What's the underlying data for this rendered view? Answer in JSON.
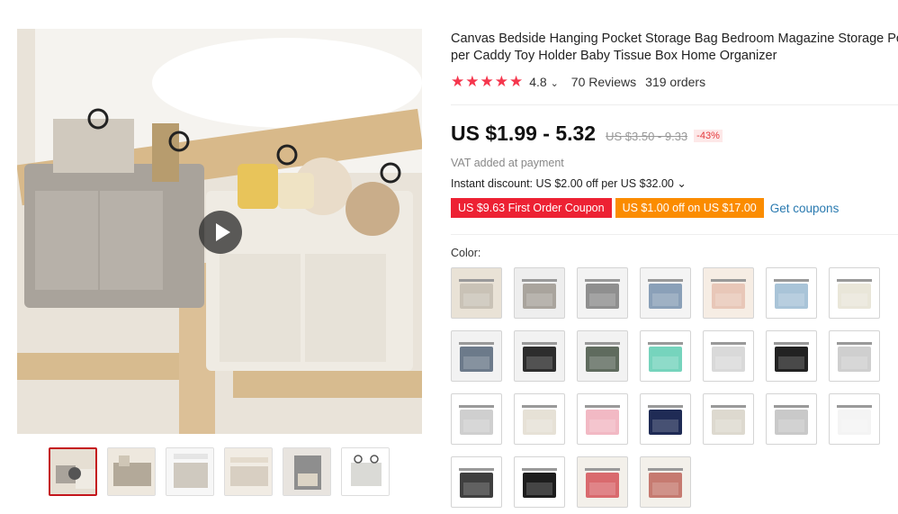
{
  "product": {
    "title_line1": "Canvas Bedside Hanging Pocket Storage Bag Bedroom Magazine Storage Pou",
    "title_line2": "per Caddy Toy Holder Baby Tissue Box Home Organizer",
    "stars": "★★★★★",
    "rating": "4.8",
    "rating_caret": "⌄",
    "reviews": "70 Reviews",
    "orders": "319 orders",
    "price": "US $1.99 - 5.32",
    "original_price": "US $3.50 - 9.33",
    "discount_badge": "-43%",
    "vat_note": "VAT added at payment",
    "instant_discount": "Instant discount: US $2.00 off per US $32.00 ⌄",
    "coupon_first_order": "US $9.63 First Order Coupon",
    "coupon_off": "US $1.00 off on US $17.00",
    "get_coupons": "Get coupons",
    "color_label": "Color:"
  },
  "gallery": {
    "main_image": "bedside-storage-bags-photo",
    "play_icon": "play-icon",
    "thumbnails": [
      {
        "label": "thumb-1",
        "active": true
      },
      {
        "label": "thumb-2",
        "active": false
      },
      {
        "label": "thumb-3",
        "active": false
      },
      {
        "label": "thumb-4",
        "active": false
      },
      {
        "label": "thumb-5",
        "active": false
      },
      {
        "label": "thumb-6",
        "active": false
      }
    ]
  },
  "colors": {
    "accent_red": "#ed2133",
    "accent_orange": "#fb8c00",
    "star_color": "#f5364d",
    "link_blue": "#2a7ab0",
    "selected_border": "#c4151c"
  },
  "swatches": [
    {
      "bg": "#e9e2d6",
      "bag": "#c9c2b6"
    },
    {
      "bg": "#eeeeee",
      "bag": "#a9a49d"
    },
    {
      "bg": "#f3f3f3",
      "bag": "#8f8f8f"
    },
    {
      "bg": "#f4f4f4",
      "bag": "#8aa0b8"
    },
    {
      "bg": "#f6ede4",
      "bag": "#e8c7b8"
    },
    {
      "bg": "#ffffff",
      "bag": "#a9c4d8"
    },
    {
      "bg": "#ffffff",
      "bag": "#e9e6d9"
    },
    {
      "bg": "#f2f2f2",
      "bag": "#6c7a8a"
    },
    {
      "bg": "#f2f2f2",
      "bag": "#2d2d2d"
    },
    {
      "bg": "#f2f2f2",
      "bag": "#5f6b5e"
    },
    {
      "bg": "#ffffff",
      "bag": "#76d4bd"
    },
    {
      "bg": "#ffffff",
      "bag": "#d9d9d9"
    },
    {
      "bg": "#ffffff",
      "bag": "#222222"
    },
    {
      "bg": "#ffffff",
      "bag": "#cfcfcf"
    },
    {
      "bg": "#ffffff",
      "bag": "#cfcfcf"
    },
    {
      "bg": "#ffffff",
      "bag": "#e6e1d6"
    },
    {
      "bg": "#ffffff",
      "bag": "#f2b9c4"
    },
    {
      "bg": "#ffffff",
      "bag": "#1f2b55"
    },
    {
      "bg": "#ffffff",
      "bag": "#ddd9cf"
    },
    {
      "bg": "#ffffff",
      "bag": "#c9c9c9"
    },
    {
      "bg": "#ffffff",
      "bag": "#f4f4f4"
    },
    {
      "bg": "#ffffff",
      "bag": "#3f3f3f"
    },
    {
      "bg": "#ffffff",
      "bag": "#1d1d1d"
    },
    {
      "bg": "#f3f0ea",
      "bag": "#d96a6e"
    },
    {
      "bg": "#f3f0ea",
      "bag": "#c67a70"
    }
  ]
}
